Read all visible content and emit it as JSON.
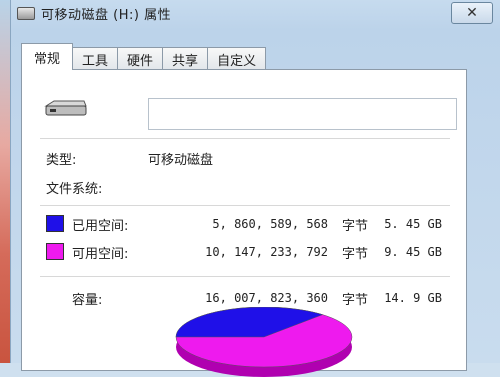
{
  "window": {
    "title": "可移动磁盘 (H:) 属性",
    "close_glyph": "✕"
  },
  "tabs": [
    {
      "label": "常规",
      "active": true
    },
    {
      "label": "工具",
      "active": false
    },
    {
      "label": "硬件",
      "active": false
    },
    {
      "label": "共享",
      "active": false
    },
    {
      "label": "自定义",
      "active": false
    }
  ],
  "general": {
    "drive_name_value": "",
    "type_label": "类型:",
    "type_value": "可移动磁盘",
    "filesystem_label": "文件系统:",
    "filesystem_value": "",
    "used": {
      "label": "已用空间:",
      "bytes": "5, 860, 589, 568",
      "unit": "字节",
      "size": "5. 45 GB",
      "color": "#1f10e8"
    },
    "free": {
      "label": "可用空间:",
      "bytes": "10, 147, 233, 792",
      "unit": "字节",
      "size": "9. 45 GB",
      "color": "#ee1aee"
    },
    "capacity": {
      "label": "容量:",
      "bytes": "16, 007, 823, 360",
      "unit": "字节",
      "size": "14. 9 GB"
    }
  },
  "icons": {
    "drive": "removable-drive-icon",
    "close": "close-icon"
  }
}
